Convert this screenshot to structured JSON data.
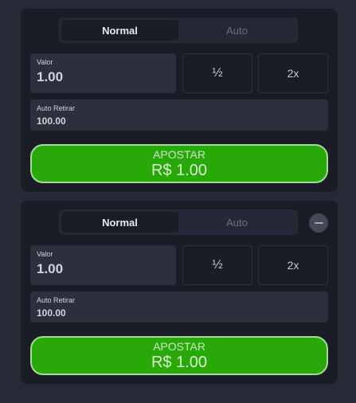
{
  "bet_panels": [
    {
      "tabs": {
        "normal": "Normal",
        "auto": "Auto"
      },
      "active_tab": "Normal",
      "amount_label": "Valor",
      "amount_value": "1.00",
      "half_label": "½",
      "double_label": "2x",
      "auto_cashout_label": "Auto Retirar",
      "auto_cashout_value": "100.00",
      "bet_label": "APOSTAR",
      "bet_amount": "R$ 1.00"
    },
    {
      "tabs": {
        "normal": "Normal",
        "auto": "Auto"
      },
      "active_tab": "Normal",
      "has_remove_button": true,
      "amount_label": "Valor",
      "amount_value": "1.00",
      "half_label": "½",
      "double_label": "2x",
      "auto_cashout_label": "Auto Retirar",
      "auto_cashout_value": "100.00",
      "bet_label": "APOSTAR",
      "bet_amount": "R$ 1.00"
    }
  ],
  "colors": {
    "page_bg": "#262a36",
    "panel_bg": "#1b1d26",
    "field_bg": "#2c2f3d",
    "bet_green": "#28a909",
    "bet_border": "#a6d99a"
  },
  "icons": {
    "remove": "minus-circle-icon"
  }
}
